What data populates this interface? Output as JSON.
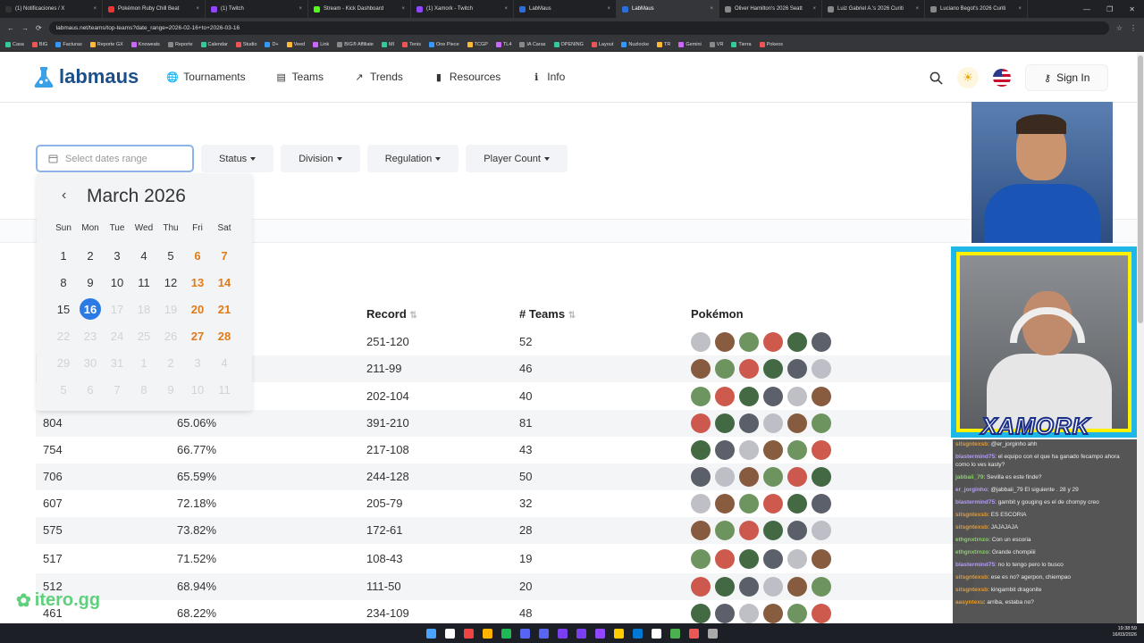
{
  "browser": {
    "tabs": [
      {
        "label": "(1) Notificaciones / X",
        "color": "#333"
      },
      {
        "label": "Pokémon Ruby Chill Beat",
        "color": "#e33"
      },
      {
        "label": "(1) Twitch",
        "color": "#9146ff"
      },
      {
        "label": "Stream - Kick Dashboard",
        "color": "#53fc18"
      },
      {
        "label": "(1) Xamork - Twitch",
        "color": "#9146ff"
      },
      {
        "label": "LabMaus",
        "color": "#2a6fdb"
      },
      {
        "label": "LabMaus",
        "color": "#2a6fdb"
      },
      {
        "label": "Oliver Hamilton's 2026 Seatt",
        "color": "#888"
      },
      {
        "label": "Luiz Gabriel A.'s 2026 Curiti",
        "color": "#888"
      },
      {
        "label": "Luciano Begot's 2026 Curiti",
        "color": "#888"
      }
    ],
    "url": "labmaus.net/teams/top-teams?date_range=2026-02-16+to+2026-03-16",
    "bookmarks": [
      "Casa",
      "BIG",
      "Facturas",
      "Reporte GX",
      "Knoweats",
      "Reporte",
      "Calendar",
      "Studio",
      "D+",
      "Veed",
      "Link",
      "BIG® Affiliate",
      "MI",
      "Tenis",
      "One Piece",
      "TCGP",
      "TL4",
      "IA Caras",
      "OPENING",
      "Layout",
      "Nuzlocke",
      "TR",
      "Gemini",
      "VR",
      "Tierra",
      "Pokeos"
    ]
  },
  "nav": {
    "logo": "labmaus",
    "items": [
      {
        "label": "Tournaments",
        "icon": "globe-icon",
        "glyph": "🌐"
      },
      {
        "label": "Teams",
        "icon": "id-card-icon",
        "glyph": "▤"
      },
      {
        "label": "Trends",
        "icon": "trend-icon",
        "glyph": "↗"
      },
      {
        "label": "Resources",
        "icon": "bookmark-icon",
        "glyph": "▮"
      },
      {
        "label": "Info",
        "icon": "info-icon",
        "glyph": "ℹ"
      }
    ],
    "signin": "Sign In"
  },
  "filters": {
    "date_placeholder": "Select dates range",
    "buttons": [
      "Status",
      "Division",
      "Regulation",
      "Player Count"
    ]
  },
  "calendar": {
    "month": "March 2026",
    "dow": [
      "Sun",
      "Mon",
      "Tue",
      "Wed",
      "Thu",
      "Fri",
      "Sat"
    ],
    "days": [
      {
        "d": "1",
        "s": ""
      },
      {
        "d": "2",
        "s": ""
      },
      {
        "d": "3",
        "s": ""
      },
      {
        "d": "4",
        "s": ""
      },
      {
        "d": "5",
        "s": ""
      },
      {
        "d": "6",
        "s": "we"
      },
      {
        "d": "7",
        "s": "we"
      },
      {
        "d": "8",
        "s": ""
      },
      {
        "d": "9",
        "s": ""
      },
      {
        "d": "10",
        "s": ""
      },
      {
        "d": "11",
        "s": ""
      },
      {
        "d": "12",
        "s": ""
      },
      {
        "d": "13",
        "s": "we"
      },
      {
        "d": "14",
        "s": "we"
      },
      {
        "d": "15",
        "s": ""
      },
      {
        "d": "16",
        "s": "sel"
      },
      {
        "d": "17",
        "s": "dis"
      },
      {
        "d": "18",
        "s": "dis"
      },
      {
        "d": "19",
        "s": "dis"
      },
      {
        "d": "20",
        "s": "we"
      },
      {
        "d": "21",
        "s": "we"
      },
      {
        "d": "22",
        "s": "dis"
      },
      {
        "d": "23",
        "s": "dis"
      },
      {
        "d": "24",
        "s": "dis"
      },
      {
        "d": "25",
        "s": "dis"
      },
      {
        "d": "26",
        "s": "dis"
      },
      {
        "d": "27",
        "s": "we"
      },
      {
        "d": "28",
        "s": "we"
      },
      {
        "d": "29",
        "s": "dis"
      },
      {
        "d": "30",
        "s": "dis"
      },
      {
        "d": "31",
        "s": "dis"
      },
      {
        "d": "1",
        "s": "dis"
      },
      {
        "d": "2",
        "s": "dis"
      },
      {
        "d": "3",
        "s": "dis"
      },
      {
        "d": "4",
        "s": "dis"
      },
      {
        "d": "5",
        "s": "dis"
      },
      {
        "d": "6",
        "s": "dis"
      },
      {
        "d": "7",
        "s": "dis"
      },
      {
        "d": "8",
        "s": "dis"
      },
      {
        "d": "9",
        "s": "dis"
      },
      {
        "d": "10",
        "s": "dis"
      },
      {
        "d": "11",
        "s": "dis"
      }
    ]
  },
  "table": {
    "headers": {
      "record": "Record",
      "teams": "# Teams",
      "pokemon": "Pokémon"
    },
    "rows": [
      {
        "c1": "",
        "c2": "",
        "record": "251-120",
        "teams": "52",
        "alt": false
      },
      {
        "c1": "",
        "c2": "",
        "record": "211-99",
        "teams": "46",
        "alt": true
      },
      {
        "c1": "",
        "c2": "",
        "record": "202-104",
        "teams": "40",
        "alt": false
      },
      {
        "c1": "804",
        "c2": "65.06%",
        "record": "391-210",
        "teams": "81",
        "alt": true
      },
      {
        "c1": "754",
        "c2": "66.77%",
        "record": "217-108",
        "teams": "43",
        "alt": false
      },
      {
        "c1": "706",
        "c2": "65.59%",
        "record": "244-128",
        "teams": "50",
        "alt": true
      },
      {
        "c1": "607",
        "c2": "72.18%",
        "record": "205-79",
        "teams": "32",
        "alt": false
      },
      {
        "c1": "575",
        "c2": "73.82%",
        "record": "172-61",
        "teams": "28",
        "alt": true
      },
      {
        "c1": "517",
        "c2": "71.52%",
        "record": "108-43",
        "teams": "19",
        "alt": false
      },
      {
        "c1": "512",
        "c2": "68.94%",
        "record": "111-50",
        "teams": "20",
        "alt": true
      },
      {
        "c1": "461",
        "c2": "68.22%",
        "record": "234-109",
        "teams": "48",
        "alt": false
      }
    ],
    "sprite_colors": [
      "#b8b8c0",
      "#7a4a2a",
      "#5e8a4e",
      "#c9473a",
      "#2f5a2f",
      "#4a4f5a"
    ]
  },
  "stream": {
    "overlay_name": "XAMORK",
    "chat": [
      {
        "user": "sitsgntexsb",
        "text": ": @er_jorginho ahh",
        "cls": ""
      },
      {
        "user": "blastermind75",
        "text": ": el equipo con el que ha ganado fecampo ahora como lo ves kasty?",
        "cls": "p"
      },
      {
        "user": "jabbaii_79",
        "text": ": Sevilla es este finde?",
        "cls": "g"
      },
      {
        "user": "er_jorginho",
        "text": ": @jabbaii_79 El siguiente . 28 y 29",
        "cls": "p"
      },
      {
        "user": "blastermind75",
        "text": ": gambit y gouging es el de chompy creo",
        "cls": "p"
      },
      {
        "user": "sitsgntexsb",
        "text": ": ES ESCORIA",
        "cls": ""
      },
      {
        "user": "sitsgntexsb",
        "text": ": JAJAJAJA",
        "cls": ""
      },
      {
        "user": "ethgnxtrnzo",
        "text": ": Con un escoria",
        "cls": "g"
      },
      {
        "user": "ethgnxtrnzo",
        "text": ": Grande chompiiii",
        "cls": "g"
      },
      {
        "user": "blastermind75",
        "text": ": no lo tengo pero lo busco",
        "cls": "p"
      },
      {
        "user": "sitsgntexsb",
        "text": ": ese es no? agerpon, chiempao",
        "cls": ""
      },
      {
        "user": "sitsgntexsb",
        "text": ": kingambit dragonite",
        "cls": ""
      },
      {
        "user": "aasyntexu",
        "text": ": arriba, estaba no?",
        "cls": ""
      }
    ],
    "watermark": "itero.gg"
  },
  "clock": {
    "time": "19:38:59",
    "date": "16/03/2026"
  }
}
